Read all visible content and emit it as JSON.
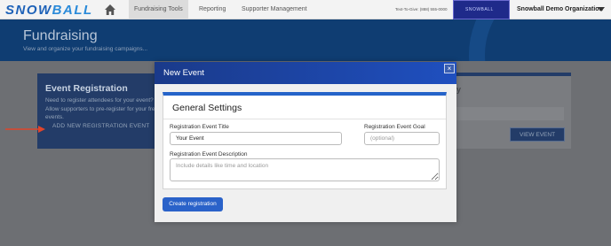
{
  "app": {
    "logo_text_a": "SNOW",
    "logo_text_b": "BALL"
  },
  "topnav": {
    "items": [
      {
        "label": "Fundraising Tools"
      },
      {
        "label": "Reporting"
      },
      {
        "label": "Supporter Management"
      }
    ],
    "text_to_give": "Text-To-Give: (888) 555-0000",
    "brand_box_label": "SNOWBALL",
    "org_name": "Snowball Demo Organization"
  },
  "header": {
    "title": "Fundraising",
    "subtitle": "View and organize your fundraising campaigns..."
  },
  "left_card": {
    "title": "Event Registration",
    "description": "Need to register attendees for your event? Allow supporters to pre-register for your free events.",
    "action_label": "ADD NEW REGISTRATION EVENT"
  },
  "right_card": {
    "title": "y",
    "button_label": "VIEW EVENT"
  },
  "modal": {
    "title": "New Event",
    "close_label": "×",
    "section_title": "General Settings",
    "fields": {
      "title_label": "Registration Event Title",
      "title_value": "Your Event",
      "goal_label": "Registration Event Goal",
      "goal_placeholder": "(optional)",
      "description_label": "Registration Event Description",
      "description_placeholder": "Include details like time and location"
    },
    "submit_label": "Create registration"
  },
  "colors": {
    "brand_blue": "#1f4fbf",
    "button_blue": "#2a62c9",
    "arrow_red": "#e0452b",
    "overlay": "#6d6f73"
  }
}
